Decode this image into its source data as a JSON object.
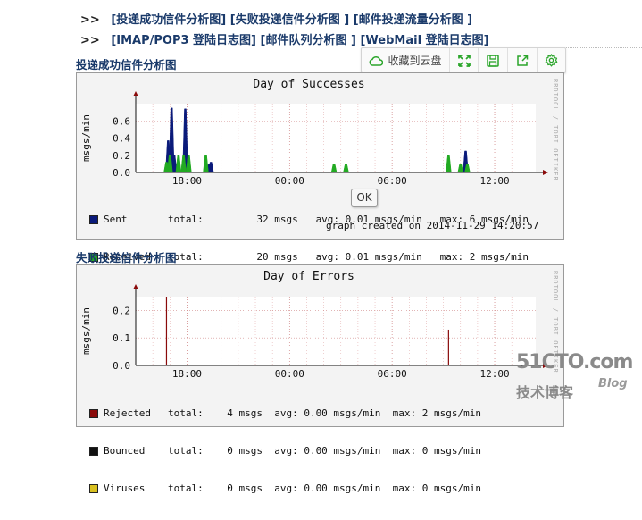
{
  "nav": {
    "row1": {
      "prefix": ">>",
      "links": [
        "[投递成功信件分析图]",
        "[失败投递信件分析图 ]",
        "[邮件投递流量分析图 ]"
      ]
    },
    "row2": {
      "prefix": ">>",
      "links": [
        "[IMAP/POP3 登陆日志图]",
        "[邮件队列分析图 ]",
        "[WebMail 登陆日志图]"
      ]
    }
  },
  "sections": [
    {
      "title": "投递成功信件分析图"
    },
    {
      "title": "失败投递信件分析图"
    }
  ],
  "toolbar": {
    "save_label": "收藏到云盘",
    "icons": [
      "cloud-icon",
      "expand-icon",
      "save-icon",
      "share-icon",
      "gear-icon"
    ],
    "accent": "#2aa52a"
  },
  "tooltip": {
    "label": "OK"
  },
  "side_label": "RRDTOOL / TOBI OETIKER",
  "charts": [
    {
      "title": "Day of Successes",
      "ylabel": "msgs/min",
      "yticks": [
        "0.0",
        "0.2",
        "0.4",
        "0.6"
      ],
      "xticks": [
        "18:00",
        "00:00",
        "06:00",
        "12:00"
      ],
      "legend": [
        {
          "name": "Sent",
          "color": "#0a1a7a",
          "text": "total:         32 msgs   avg: 0.01 msgs/min   max: 6 msgs/min"
        },
        {
          "name": "Received",
          "color": "#22aa22",
          "text": "total:         20 msgs   avg: 0.01 msgs/min   max: 2 msgs/min"
        }
      ],
      "created": "graph created on 2014-11-29 14:20:57"
    },
    {
      "title": "Day of Errors",
      "ylabel": "msgs/min",
      "yticks": [
        "0.0",
        "0.1",
        "0.2"
      ],
      "xticks": [
        "18:00",
        "00:00",
        "06:00",
        "12:00"
      ],
      "legend": [
        {
          "name": "Rejected",
          "color": "#8a0a0a",
          "text": "total:    4 msgs  avg: 0.00 msgs/min  max: 2 msgs/min"
        },
        {
          "name": "Bounced",
          "color": "#111111",
          "text": "total:    0 msgs  avg: 0.00 msgs/min  max: 0 msgs/min"
        },
        {
          "name": "Viruses",
          "color": "#d8c020",
          "text": "total:    0 msgs  avg: 0.00 msgs/min  max: 0 msgs/min"
        }
      ]
    }
  ],
  "chart_data": [
    {
      "type": "area",
      "title": "Day of Successes",
      "xlabel": "",
      "ylabel": "msgs/min",
      "ylim": [
        0,
        0.8
      ],
      "x_ticks": [
        "18:00",
        "00:00",
        "06:00",
        "12:00"
      ],
      "series": [
        {
          "name": "Sent",
          "color": "#0a1a7a",
          "points": [
            [
              16.9,
              0.37
            ],
            [
              17.1,
              0.75
            ],
            [
              17.25,
              0.2
            ],
            [
              17.9,
              0.74
            ],
            [
              19.3,
              0.1
            ],
            [
              19.4,
              0.12
            ],
            [
              10.3,
              0.25
            ]
          ]
        },
        {
          "name": "Received",
          "color": "#22aa22",
          "points": [
            [
              16.8,
              0.12
            ],
            [
              17.0,
              0.2
            ],
            [
              17.5,
              0.2
            ],
            [
              17.8,
              0.2
            ],
            [
              18.1,
              0.2
            ],
            [
              19.1,
              0.2
            ],
            [
              2.6,
              0.1
            ],
            [
              3.3,
              0.1
            ],
            [
              9.3,
              0.2
            ],
            [
              10.0,
              0.1
            ],
            [
              10.4,
              0.1
            ]
          ]
        }
      ],
      "created": "graph created on 2014-11-29 14:20:57"
    },
    {
      "type": "bar",
      "title": "Day of Errors",
      "xlabel": "",
      "ylabel": "msgs/min",
      "ylim": [
        0,
        0.25
      ],
      "x_ticks": [
        "18:00",
        "00:00",
        "06:00",
        "12:00"
      ],
      "series": [
        {
          "name": "Rejected",
          "color": "#8a0a0a",
          "points": [
            [
              16.8,
              0.25
            ],
            [
              9.3,
              0.13
            ]
          ]
        },
        {
          "name": "Bounced",
          "color": "#111111",
          "points": []
        },
        {
          "name": "Viruses",
          "color": "#d8c020",
          "points": []
        }
      ]
    }
  ]
}
